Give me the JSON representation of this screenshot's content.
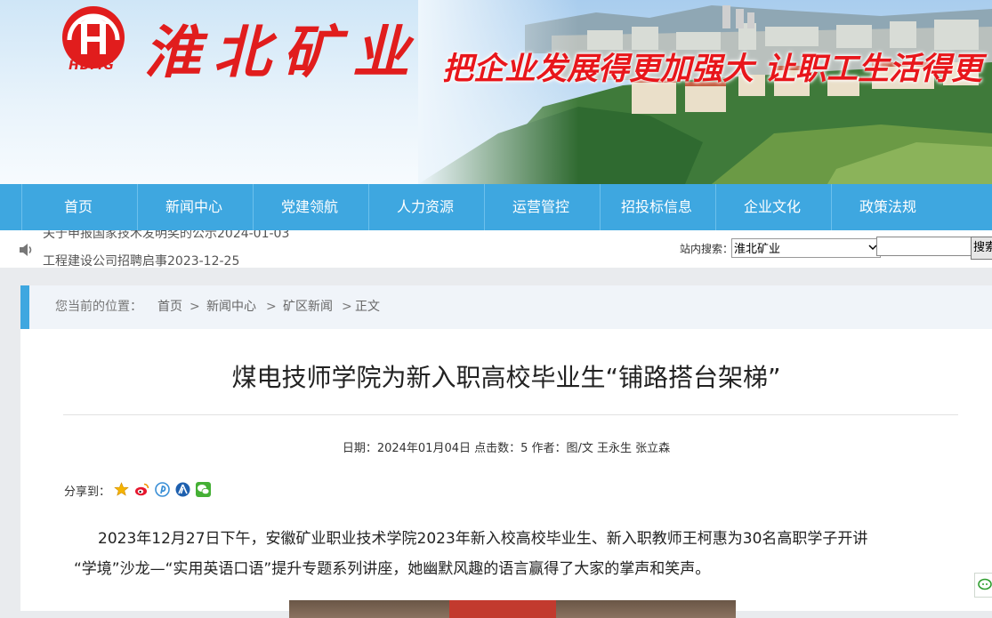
{
  "header": {
    "logo_text": "HBMG",
    "company_name": "淮北矿业",
    "slogan": "把企业发展得更加强大  让职工生活得更"
  },
  "nav": {
    "items": [
      {
        "label": "首页"
      },
      {
        "label": "新闻中心"
      },
      {
        "label": "党建领航"
      },
      {
        "label": "人力资源"
      },
      {
        "label": "运营管控"
      },
      {
        "label": "招投标信息"
      },
      {
        "label": "企业文化"
      },
      {
        "label": "政策法规"
      }
    ]
  },
  "ticker": {
    "items": [
      "关于申报国家技术发明奖的公示2024-01-03",
      "工程建设公司招聘启事2023-12-25"
    ]
  },
  "site_search": {
    "label": "站内搜索：",
    "scope_selected": "淮北矿业",
    "query": "",
    "button": "搜索"
  },
  "breadcrumb": {
    "prefix": "您当前的位置：",
    "items": [
      "首页",
      "新闻中心",
      "矿区新闻",
      "正文"
    ],
    "separator": ">"
  },
  "article": {
    "title": "煤电技师学院为新入职高校毕业生“铺路搭台架梯”",
    "meta": "日期：2024年01月04日  点击数：5  作者：图/文 王永生 张立森",
    "share_label": "分享到：",
    "paragraph1_line1": "2023年12月27日下午，安徽矿业职业技术学院2023年新入校高校毕业生、新入职教师王柯惠为30名高职学子开讲",
    "paragraph1_line2": "“学境”沙龙—“实用英语口语”提升专题系列讲座，她幽默风趣的语言赢得了大家的掌声和笑声。"
  },
  "share_icons": [
    "qzone-icon",
    "weibo-icon",
    "pinterest-icon",
    "renren-icon",
    "wechat-icon"
  ],
  "colors": {
    "nav_bg": "#3ea7e0",
    "brand_red": "#e11d1d",
    "breadcrumb_bg": "#f0f4f9"
  }
}
